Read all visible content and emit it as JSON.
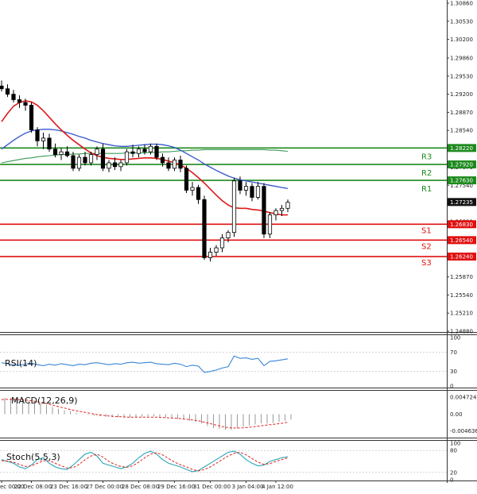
{
  "chart_data": {
    "type": "line",
    "price": {
      "y_ticks": [
        "1.30860",
        "1.30530",
        "1.30200",
        "1.29860",
        "1.29530",
        "1.29200",
        "1.28870",
        "1.28540",
        "1.28200",
        "1.27870",
        "1.27540",
        "1.27210",
        "1.26880",
        "1.26550",
        "1.26210",
        "1.25870",
        "1.25540",
        "1.25210",
        "1.24880"
      ],
      "ylim": [
        1.2488,
        1.3086
      ],
      "current_price": "1.27235",
      "candles": [
        {
          "o": 1.2935,
          "h": 1.2945,
          "l": 1.2925,
          "c": 1.293
        },
        {
          "o": 1.293,
          "h": 1.2938,
          "l": 1.2915,
          "c": 1.292
        },
        {
          "o": 1.292,
          "h": 1.2928,
          "l": 1.2905,
          "c": 1.291
        },
        {
          "o": 1.291,
          "h": 1.2918,
          "l": 1.2895,
          "c": 1.2905
        },
        {
          "o": 1.2905,
          "h": 1.2912,
          "l": 1.289,
          "c": 1.29
        },
        {
          "o": 1.29,
          "h": 1.2905,
          "l": 1.285,
          "c": 1.2855
        },
        {
          "o": 1.2855,
          "h": 1.286,
          "l": 1.2825,
          "c": 1.2835
        },
        {
          "o": 1.2835,
          "h": 1.285,
          "l": 1.282,
          "c": 1.284
        },
        {
          "o": 1.284,
          "h": 1.2848,
          "l": 1.2815,
          "c": 1.282
        },
        {
          "o": 1.282,
          "h": 1.283,
          "l": 1.2805,
          "c": 1.281
        },
        {
          "o": 1.281,
          "h": 1.2822,
          "l": 1.28,
          "c": 1.2815
        },
        {
          "o": 1.2815,
          "h": 1.2825,
          "l": 1.2805,
          "c": 1.2808
        },
        {
          "o": 1.2808,
          "h": 1.2815,
          "l": 1.278,
          "c": 1.2785
        },
        {
          "o": 1.2785,
          "h": 1.281,
          "l": 1.278,
          "c": 1.2805
        },
        {
          "o": 1.2805,
          "h": 1.2815,
          "l": 1.279,
          "c": 1.2795
        },
        {
          "o": 1.2795,
          "h": 1.2815,
          "l": 1.279,
          "c": 1.281
        },
        {
          "o": 1.281,
          "h": 1.2825,
          "l": 1.28,
          "c": 1.282
        },
        {
          "o": 1.282,
          "h": 1.283,
          "l": 1.278,
          "c": 1.2785
        },
        {
          "o": 1.2785,
          "h": 1.28,
          "l": 1.2778,
          "c": 1.2795
        },
        {
          "o": 1.2795,
          "h": 1.2805,
          "l": 1.2782,
          "c": 1.2788
        },
        {
          "o": 1.2788,
          "h": 1.28,
          "l": 1.278,
          "c": 1.2795
        },
        {
          "o": 1.2795,
          "h": 1.282,
          "l": 1.279,
          "c": 1.2815
        },
        {
          "o": 1.2815,
          "h": 1.2828,
          "l": 1.2805,
          "c": 1.2812
        },
        {
          "o": 1.2812,
          "h": 1.2825,
          "l": 1.2805,
          "c": 1.282
        },
        {
          "o": 1.282,
          "h": 1.2828,
          "l": 1.281,
          "c": 1.2815
        },
        {
          "o": 1.2815,
          "h": 1.283,
          "l": 1.281,
          "c": 1.2825
        },
        {
          "o": 1.2825,
          "h": 1.283,
          "l": 1.28,
          "c": 1.2805
        },
        {
          "o": 1.2805,
          "h": 1.2812,
          "l": 1.2788,
          "c": 1.2795
        },
        {
          "o": 1.2795,
          "h": 1.2805,
          "l": 1.278,
          "c": 1.2785
        },
        {
          "o": 1.2785,
          "h": 1.2805,
          "l": 1.278,
          "c": 1.28
        },
        {
          "o": 1.28,
          "h": 1.2808,
          "l": 1.2778,
          "c": 1.2785
        },
        {
          "o": 1.2785,
          "h": 1.279,
          "l": 1.274,
          "c": 1.2745
        },
        {
          "o": 1.2745,
          "h": 1.276,
          "l": 1.2735,
          "c": 1.275
        },
        {
          "o": 1.275,
          "h": 1.2755,
          "l": 1.272,
          "c": 1.2728
        },
        {
          "o": 1.2728,
          "h": 1.2735,
          "l": 1.2618,
          "c": 1.2622
        },
        {
          "o": 1.2622,
          "h": 1.264,
          "l": 1.2615,
          "c": 1.2632
        },
        {
          "o": 1.2632,
          "h": 1.2645,
          "l": 1.2625,
          "c": 1.264
        },
        {
          "o": 1.264,
          "h": 1.2665,
          "l": 1.2632,
          "c": 1.2658
        },
        {
          "o": 1.2658,
          "h": 1.2672,
          "l": 1.265,
          "c": 1.2668
        },
        {
          "o": 1.2668,
          "h": 1.2768,
          "l": 1.266,
          "c": 1.2762
        },
        {
          "o": 1.2762,
          "h": 1.277,
          "l": 1.2738,
          "c": 1.2745
        },
        {
          "o": 1.2745,
          "h": 1.276,
          "l": 1.2735,
          "c": 1.2752
        },
        {
          "o": 1.2752,
          "h": 1.2758,
          "l": 1.2725,
          "c": 1.2732
        },
        {
          "o": 1.2732,
          "h": 1.276,
          "l": 1.2728,
          "c": 1.2752
        },
        {
          "o": 1.2752,
          "h": 1.2758,
          "l": 1.2658,
          "c": 1.2665
        },
        {
          "o": 1.2665,
          "h": 1.2705,
          "l": 1.2658,
          "c": 1.27
        },
        {
          "o": 1.27,
          "h": 1.2712,
          "l": 1.269,
          "c": 1.2708
        },
        {
          "o": 1.2708,
          "h": 1.2718,
          "l": 1.2698,
          "c": 1.2712
        },
        {
          "o": 1.2712,
          "h": 1.2728,
          "l": 1.2705,
          "c": 1.2723
        }
      ],
      "ma_red": [
        1.287,
        1.2885,
        1.2898,
        1.2905,
        1.2908,
        1.2906,
        1.29,
        1.289,
        1.2878,
        1.2866,
        1.2855,
        1.2845,
        1.2836,
        1.2828,
        1.282,
        1.2813,
        1.2808,
        1.2805,
        1.2803,
        1.2802,
        1.2801,
        1.2801,
        1.2802,
        1.2803,
        1.2804,
        1.2804,
        1.2803,
        1.2801,
        1.2798,
        1.2795,
        1.2791,
        1.2785,
        1.2777,
        1.2768,
        1.2758,
        1.2747,
        1.2736,
        1.2726,
        1.2718,
        1.2713,
        1.2712,
        1.2712,
        1.271,
        1.2709,
        1.2707,
        1.2704,
        1.2702,
        1.27,
        1.27
      ],
      "ma_blue": [
        1.282,
        1.2828,
        1.2836,
        1.2843,
        1.2849,
        1.2853,
        1.2855,
        1.2856,
        1.2856,
        1.2855,
        1.2853,
        1.285,
        1.2847,
        1.2843,
        1.284,
        1.2836,
        1.2833,
        1.283,
        1.2828,
        1.2826,
        1.2825,
        1.2825,
        1.2826,
        1.2827,
        1.2828,
        1.2829,
        1.2829,
        1.2828,
        1.2826,
        1.2823,
        1.2818,
        1.2812,
        1.2806,
        1.28,
        1.2793,
        1.2787,
        1.2781,
        1.2776,
        1.2771,
        1.2767,
        1.2764,
        1.2762,
        1.276,
        1.2758,
        1.2756,
        1.2754,
        1.2752,
        1.275,
        1.2748
      ],
      "ma_green": [
        1.2795,
        1.2797,
        1.2799,
        1.2801,
        1.2803,
        1.2804,
        1.2806,
        1.2807,
        1.2808,
        1.2809,
        1.281,
        1.281,
        1.2811,
        1.2811,
        1.2812,
        1.2812,
        1.2812,
        1.2812,
        1.2812,
        1.2812,
        1.2812,
        1.2813,
        1.2813,
        1.2813,
        1.2813,
        1.2814,
        1.2814,
        1.2815,
        1.2815,
        1.2816,
        1.2817,
        1.2817,
        1.2818,
        1.2818,
        1.2819,
        1.2819,
        1.2819,
        1.2819,
        1.2819,
        1.2819,
        1.2819,
        1.2819,
        1.2819,
        1.2819,
        1.2819,
        1.2818,
        1.2818,
        1.2817,
        1.2816
      ],
      "levels": [
        {
          "name": "R3",
          "value": 1.2822,
          "badge": "1.28220",
          "color": "#1e8a1e"
        },
        {
          "name": "R2",
          "value": 1.2792,
          "badge": "1.27920",
          "color": "#1e8a1e"
        },
        {
          "name": "R1",
          "value": 1.2763,
          "badge": "1.27630",
          "color": "#1e8a1e"
        },
        {
          "name": "S1",
          "value": 1.2683,
          "badge": "1.26830",
          "color": "#e01010"
        },
        {
          "name": "S2",
          "value": 1.2654,
          "badge": "1.26540",
          "color": "#e01010"
        },
        {
          "name": "S3",
          "value": 1.2624,
          "badge": "1.26240",
          "color": "#e01010"
        }
      ]
    },
    "rsi": {
      "label": "RSI(14)",
      "y_ticks": [
        "100",
        "70",
        "30",
        "0"
      ],
      "ylim": [
        0,
        100
      ],
      "values": [
        48,
        46,
        44,
        43,
        45,
        47,
        44,
        42,
        45,
        43,
        46,
        44,
        42,
        45,
        44,
        47,
        48,
        46,
        44,
        46,
        45,
        48,
        49,
        47,
        48,
        49,
        46,
        45,
        44,
        47,
        45,
        40,
        43,
        41,
        28,
        30,
        33,
        37,
        40,
        62,
        57,
        58,
        55,
        57,
        42,
        51,
        52,
        54,
        56
      ]
    },
    "macd": {
      "label": "MACD(12,26,9)",
      "y_ticks": [
        "0.004724",
        "0.00",
        "-0.004636"
      ],
      "ylim": [
        -0.006,
        0.006
      ],
      "histogram": [
        0.0045,
        0.0044,
        0.0042,
        0.004,
        0.0037,
        0.0034,
        0.003,
        0.0025,
        0.002,
        0.0015,
        0.0011,
        0.0008,
        0.0004,
        0.0001,
        -0.0002,
        -0.0004,
        -0.0006,
        -0.0007,
        -0.0008,
        -0.0009,
        -0.0009,
        -0.0009,
        -0.0008,
        -0.0007,
        -0.0006,
        -0.0006,
        -0.0007,
        -0.0009,
        -0.0011,
        -0.0013,
        -0.0015,
        -0.0018,
        -0.0021,
        -0.0025,
        -0.0033,
        -0.0038,
        -0.0041,
        -0.0043,
        -0.0043,
        -0.0038,
        -0.0034,
        -0.0031,
        -0.0028,
        -0.0025,
        -0.0026,
        -0.0024,
        -0.0021,
        -0.0018,
        -0.0015
      ],
      "signal": [
        0.004,
        0.0041,
        0.0041,
        0.004,
        0.0039,
        0.0037,
        0.0034,
        0.0031,
        0.0027,
        0.0023,
        0.0019,
        0.0015,
        0.0011,
        0.0008,
        0.0005,
        0.0002,
        -0.0001,
        -0.0003,
        -0.0005,
        -0.0006,
        -0.0007,
        -0.0008,
        -0.0008,
        -0.0008,
        -0.0008,
        -0.0008,
        -0.0008,
        -0.0009,
        -0.001,
        -0.0011,
        -0.0012,
        -0.0014,
        -0.0016,
        -0.0018,
        -0.0022,
        -0.0026,
        -0.003,
        -0.0034,
        -0.0037,
        -0.0038,
        -0.0038,
        -0.0037,
        -0.0035,
        -0.0033,
        -0.0031,
        -0.0029,
        -0.0027,
        -0.0025,
        -0.0022
      ]
    },
    "stoch": {
      "label": "Stoch(5,5,3)",
      "y_ticks": [
        "100",
        "80",
        "20",
        "0"
      ],
      "ylim": [
        0,
        100
      ],
      "k": [
        55,
        50,
        45,
        35,
        30,
        40,
        55,
        60,
        45,
        35,
        30,
        28,
        40,
        55,
        70,
        75,
        65,
        45,
        40,
        35,
        30,
        35,
        45,
        60,
        72,
        78,
        70,
        55,
        45,
        40,
        35,
        28,
        22,
        25,
        35,
        45,
        55,
        65,
        75,
        78,
        70,
        55,
        45,
        38,
        40,
        50,
        55,
        60,
        63
      ],
      "d": [
        52,
        51,
        48,
        42,
        36,
        38,
        45,
        52,
        52,
        45,
        38,
        32,
        33,
        42,
        55,
        65,
        70,
        62,
        50,
        42,
        36,
        34,
        38,
        48,
        60,
        70,
        74,
        68,
        58,
        48,
        41,
        35,
        28,
        24,
        28,
        35,
        45,
        55,
        65,
        72,
        75,
        68,
        58,
        48,
        42,
        44,
        50,
        55,
        60
      ]
    },
    "x_ticks": [
      {
        "index": 0,
        "label": "ec 00:00"
      },
      {
        "index": 5,
        "label": "22 Dec 08:00"
      },
      {
        "index": 11,
        "label": "23 Dec 16:00"
      },
      {
        "index": 17,
        "label": "27 Dec 00:00"
      },
      {
        "index": 23,
        "label": "28 Dec 08:00"
      },
      {
        "index": 29,
        "label": "29 Dec 16:00"
      },
      {
        "index": 35,
        "label": "31 Dec 00:00"
      },
      {
        "index": 41,
        "label": "3 Jan 04:00"
      },
      {
        "index": 46,
        "label": "4 Jan 12:00"
      }
    ]
  }
}
